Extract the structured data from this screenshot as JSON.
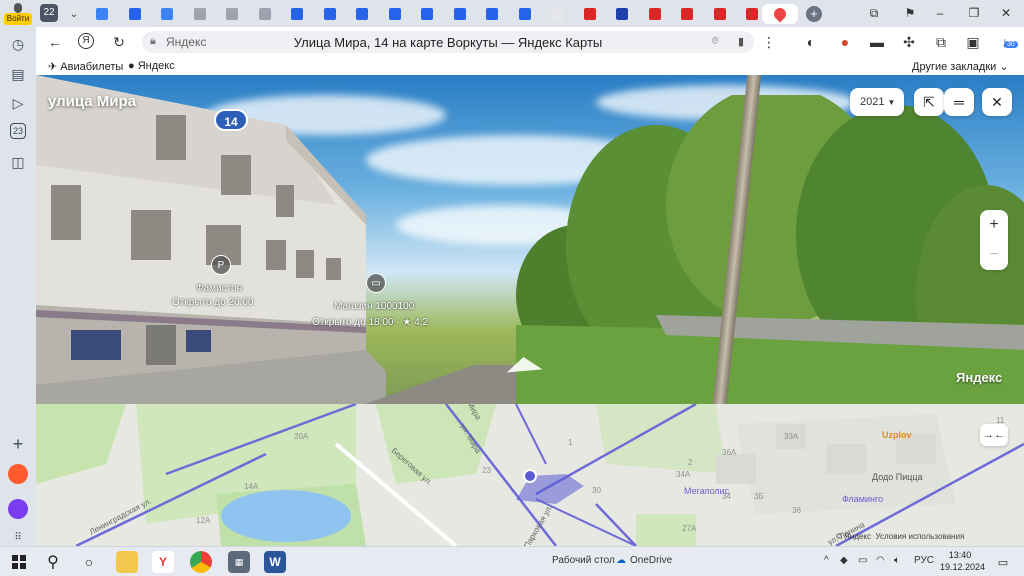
{
  "left_rail": {
    "login_label": "Войти",
    "badge_23": "23"
  },
  "tabs": {
    "count": "22",
    "favicon_colors": [
      "#3b82f6",
      "#2563eb",
      "#3b82f6",
      "#9ca3af",
      "#9ca3af",
      "#9ca3af",
      "#2563eb",
      "#2563eb",
      "#2563eb",
      "#2563eb",
      "#2563eb",
      "#2563eb",
      "#2563eb",
      "#2563eb",
      "#e5e7eb",
      "#dc2626",
      "#1e40af",
      "#dc2626",
      "#dc2626",
      "#dc2626",
      "#dc2626"
    ],
    "active_favicon_color": "#ef4444"
  },
  "address": {
    "domain": "Яндекс",
    "title": "Улица Мира, 14 на карте Воркуты — Яндекс Карты"
  },
  "bookmarks": {
    "item1": "Авиабилеты",
    "item2": "Яндекс",
    "other": "Другие закладки"
  },
  "extension_badge": "30",
  "panorama": {
    "street": "улица Мира",
    "house_number": "14",
    "year": "2021",
    "watermark": "Яндекс",
    "poi1_name": "Фамистон",
    "poi1_hours": "Открыто до 20:00",
    "poi2_name": "Магазин 1000100",
    "poi2_hours": "Открыто до 18:00 · ★ 4,2"
  },
  "map": {
    "labels": {
      "leningradskaya": "Ленинградская ул.",
      "beregovaya": "Береговая ул.",
      "mira": "ул. Мира",
      "parkovaya": "Парковая ул.",
      "lenina": "ул. Ленина",
      "mira_top": "Мира"
    },
    "numbers": [
      "20А",
      "14А",
      "12А",
      "23",
      "30",
      "1",
      "34А",
      "36А",
      "33А",
      "34",
      "36",
      "27А",
      "3Б",
      "2",
      "11"
    ],
    "poi_uzplov": "Uzplov",
    "poi_dodo": "Додо Пицца",
    "poi_flamingo": "Фламинго",
    "poi_megapolis": "Мегаполис",
    "footer_brand": "© Яндекс",
    "footer_terms": "Условия использования"
  },
  "taskbar": {
    "desktop": "Рабочий стол",
    "onedrive": "OneDrive",
    "lang": "РУС",
    "time": "13:40",
    "date": "19.12.2024"
  }
}
